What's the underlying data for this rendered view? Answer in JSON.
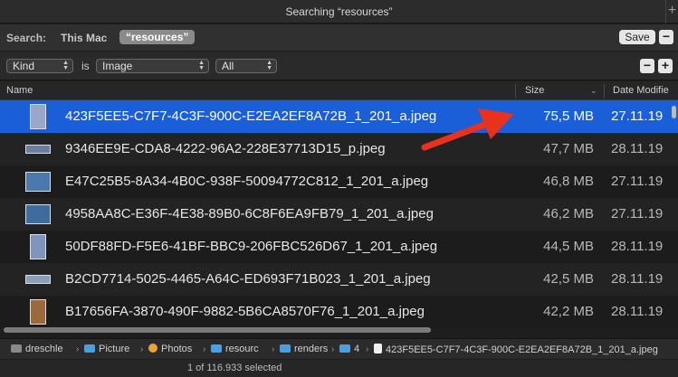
{
  "window": {
    "title": "Searching “resources”"
  },
  "scope": {
    "label": "Search:",
    "this_mac": "This Mac",
    "token": "“resources”",
    "save_label": "Save",
    "remove_label": "−"
  },
  "criteria": {
    "field": "Kind",
    "operator": "is",
    "value": "Image",
    "qualifier": "All",
    "remove_label": "−",
    "add_label": "+"
  },
  "columns": {
    "name": "Name",
    "size": "Size",
    "date": "Date Modifie"
  },
  "files": [
    {
      "name": "423F5EE5-C7F7-4C3F-900C-E2EA2EF8A72B_1_201_a.jpeg",
      "size": "75,5 MB",
      "date": "27.11.19",
      "selected": true,
      "thumb_color": "#9aa7c8",
      "thumb_shape": "tall"
    },
    {
      "name": "9346EE9E-CDA8-4222-96A2-228E37713D15_p.jpeg",
      "size": "47,7 MB",
      "date": "28.11.19",
      "selected": false,
      "thumb_color": "#6a7ea0",
      "thumb_shape": "wide"
    },
    {
      "name": "E47C25B5-8A34-4B0C-938F-50094772C812_1_201_a.jpeg",
      "size": "46,8 MB",
      "date": "27.11.19",
      "selected": false,
      "thumb_color": "#4c78b0",
      "thumb_shape": "normal"
    },
    {
      "name": "4958AA8C-E36F-4E38-89B0-6C8F6EA9FB79_1_201_a.jpeg",
      "size": "46,2 MB",
      "date": "27.11.19",
      "selected": false,
      "thumb_color": "#3f6c9e",
      "thumb_shape": "normal"
    },
    {
      "name": "50DF88FD-F5E6-41BF-BBC9-206FBC526D67_1_201_a.jpeg",
      "size": "44,5 MB",
      "date": "28.11.19",
      "selected": false,
      "thumb_color": "#7e96bc",
      "thumb_shape": "tall"
    },
    {
      "name": "B2CD7714-5025-4465-A64C-ED693F71B023_1_201_a.jpeg",
      "size": "42,5 MB",
      "date": "28.11.19",
      "selected": false,
      "thumb_color": "#8aa0b8",
      "thumb_shape": "wide"
    },
    {
      "name": "B17656FA-3870-490F-9882-5B6CA8570F76_1_201_a.jpeg",
      "size": "42,2 MB",
      "date": "28.11.19",
      "selected": false,
      "thumb_color": "#9a6a3a",
      "thumb_shape": "tall"
    }
  ],
  "path": [
    {
      "label": "dreschle",
      "icon": "home-icon"
    },
    {
      "label": "Picture",
      "icon": "folder-icon"
    },
    {
      "label": "Photos",
      "icon": "photos-icon"
    },
    {
      "label": "resourc",
      "icon": "folder-icon"
    },
    {
      "label": "renders",
      "icon": "folder-icon"
    },
    {
      "label": "4",
      "icon": "folder-icon"
    },
    {
      "label": "423F5EE5-C7F7-4C3F-900C-E2EA2EF8A72B_1_201_a.jpeg",
      "icon": "file-icon"
    }
  ],
  "path_separator": "›",
  "status": {
    "text": "1 of 116.933 selected"
  },
  "colors": {
    "selection": "#1a5ed8",
    "annotation_arrow": "#e8321e"
  }
}
